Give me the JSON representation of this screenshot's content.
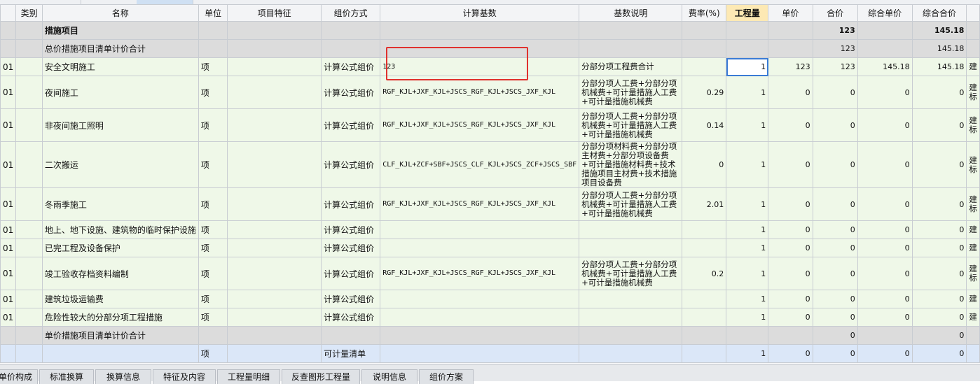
{
  "columns": [
    "",
    "类别",
    "名称",
    "单位",
    "项目特征",
    "组价方式",
    "计算基数",
    "基数说明",
    "费率(%)",
    "工程量",
    "单价",
    "合价",
    "综合单价",
    "综合合价",
    ""
  ],
  "rows": [
    {
      "type": "top",
      "cells": [
        "",
        "",
        "措施项目",
        "",
        "",
        "",
        "",
        "",
        "",
        "",
        "",
        "123",
        "",
        "145.18",
        ""
      ]
    },
    {
      "type": "sub",
      "cells": [
        "",
        "",
        "总价措施项目清单计价合计",
        "",
        "",
        "",
        "",
        "",
        "",
        "",
        "",
        "123",
        "",
        "145.18",
        ""
      ]
    },
    {
      "type": "item",
      "cells": [
        "01",
        "",
        "安全文明施工",
        "项",
        "",
        "计算公式组价",
        "123",
        "分部分项工程费合计",
        "",
        "1",
        "123",
        "123",
        "145.18",
        "145.18",
        "建"
      ]
    },
    {
      "type": "item",
      "cells": [
        "01",
        "",
        "夜间施工",
        "项",
        "",
        "计算公式组价",
        "RGF_KJL+JXF_KJL+JSCS_RGF_KJL+JSCS_JXF_KJL",
        "分部分项人工费+分部分项机械费+可计量措施人工费+可计量措施机械费",
        "0.29",
        "1",
        "0",
        "0",
        "0",
        "0",
        "建标"
      ]
    },
    {
      "type": "item",
      "cells": [
        "01",
        "",
        "非夜间施工照明",
        "项",
        "",
        "计算公式组价",
        "RGF_KJL+JXF_KJL+JSCS_RGF_KJL+JSCS_JXF_KJL",
        "分部分项人工费+分部分项机械费+可计量措施人工费+可计量措施机械费",
        "0.14",
        "1",
        "0",
        "0",
        "0",
        "0",
        "建标"
      ]
    },
    {
      "type": "item",
      "cells": [
        "01",
        "",
        "二次搬运",
        "项",
        "",
        "计算公式组价",
        "CLF_KJL+ZCF+SBF+JSCS_CLF_KJL+JSCS_ZCF+JSCS_SBF",
        "分部分项材料费+分部分项主材费+分部分项设备费+可计量措施材料费+技术措施项目主材费+技术措施项目设备费",
        "0",
        "1",
        "0",
        "0",
        "0",
        "0",
        "建标"
      ]
    },
    {
      "type": "item",
      "cells": [
        "01",
        "",
        "冬雨季施工",
        "项",
        "",
        "计算公式组价",
        "RGF_KJL+JXF_KJL+JSCS_RGF_KJL+JSCS_JXF_KJL",
        "分部分项人工费+分部分项机械费+可计量措施人工费+可计量措施机械费",
        "2.01",
        "1",
        "0",
        "0",
        "0",
        "0",
        "建标"
      ]
    },
    {
      "type": "item",
      "cells": [
        "01",
        "",
        "地上、地下设施、建筑物的临时保护设施",
        "项",
        "",
        "计算公式组价",
        "",
        "",
        "",
        "1",
        "0",
        "0",
        "0",
        "0",
        "建"
      ]
    },
    {
      "type": "item",
      "cells": [
        "01",
        "",
        "已完工程及设备保护",
        "项",
        "",
        "计算公式组价",
        "",
        "",
        "",
        "1",
        "0",
        "0",
        "0",
        "0",
        "建"
      ]
    },
    {
      "type": "item",
      "cells": [
        "01",
        "",
        "竣工验收存档资料编制",
        "项",
        "",
        "计算公式组价",
        "RGF_KJL+JXF_KJL+JSCS_RGF_KJL+JSCS_JXF_KJL",
        "分部分项人工费+分部分项机械费+可计量措施人工费+可计量措施机械费",
        "0.2",
        "1",
        "0",
        "0",
        "0",
        "0",
        "建标"
      ]
    },
    {
      "type": "item",
      "cells": [
        "01",
        "",
        "建筑垃圾运输费",
        "项",
        "",
        "计算公式组价",
        "",
        "",
        "",
        "1",
        "0",
        "0",
        "0",
        "0",
        "建"
      ]
    },
    {
      "type": "item",
      "cells": [
        "01",
        "",
        "危险性较大的分部分项工程措施",
        "项",
        "",
        "计算公式组价",
        "",
        "",
        "",
        "1",
        "0",
        "0",
        "0",
        "0",
        "建"
      ]
    },
    {
      "type": "sub",
      "cells": [
        "",
        "",
        "单价措施项目清单计价合计",
        "",
        "",
        "",
        "",
        "",
        "",
        "",
        "",
        "0",
        "",
        "0",
        ""
      ]
    },
    {
      "type": "unit",
      "cells": [
        "",
        "",
        "",
        "项",
        "",
        "可计量清单",
        "",
        "",
        "",
        "1",
        "0",
        "0",
        "0",
        "0",
        ""
      ]
    }
  ],
  "bottom_tabs": [
    "单价构成",
    "标准换算",
    "换算信息",
    "特征及内容",
    "工程量明细",
    "反查图形工程量",
    "说明信息",
    "组价方案"
  ],
  "colors": {
    "item_row": "#eff8e8",
    "summary_row": "#dcdcdc",
    "unit_row": "#dbe7f8",
    "highlight_box": "#e0322e",
    "header_active": "#fde9b4"
  }
}
